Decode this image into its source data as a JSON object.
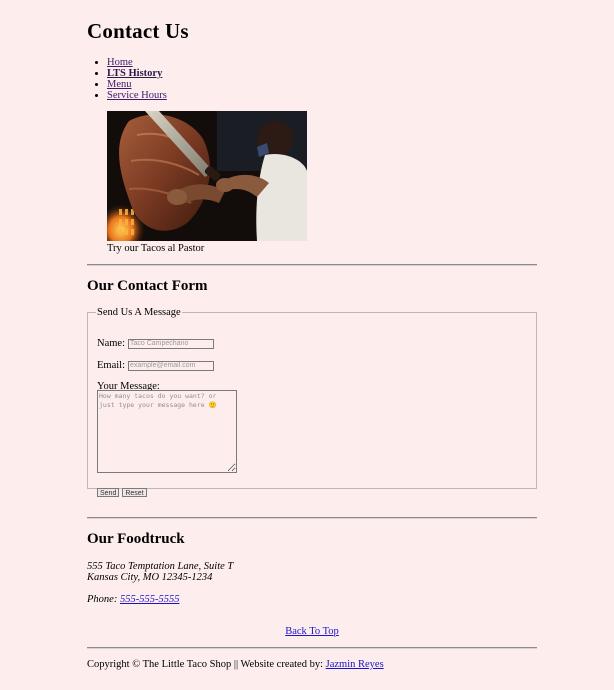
{
  "page": {
    "title": "Contact Us"
  },
  "nav": {
    "items": [
      {
        "label": "Home",
        "current": false
      },
      {
        "label": "LTS History",
        "current": true
      },
      {
        "label": "Menu",
        "current": false
      },
      {
        "label": "Service Hours",
        "current": false
      }
    ]
  },
  "hero": {
    "caption": "Try our Tacos al Pastor",
    "image_subject": "chef-carving-al-pastor-spit"
  },
  "contact_form": {
    "heading": "Our Contact Form",
    "legend": "Send Us A Message",
    "name_label": "Name:",
    "name_placeholder": "Taco Campechano",
    "email_label": "Email:",
    "email_placeholder": "example@email.com",
    "message_label": "Your Message:",
    "message_placeholder": "How many tacos do you want? or just type your message here 🙂",
    "send_label": "Send",
    "reset_label": "Reset"
  },
  "foodtruck": {
    "heading": "Our Foodtruck",
    "address_line1": "555 Taco Temptation Lane, Suite T",
    "address_line2": "Kansas City, MO 12345-1234",
    "phone_label": "Phone:",
    "phone_number": "555-555-5555"
  },
  "back_to_top": "Back To Top",
  "footer": {
    "text": "Copyright © The Little Taco Shop || Website created by:",
    "author": "Jazmin Reyes"
  },
  "colors": {
    "background": "#fdeeed",
    "link": "#1b13c9",
    "nav_link": "#3d1a6e"
  }
}
